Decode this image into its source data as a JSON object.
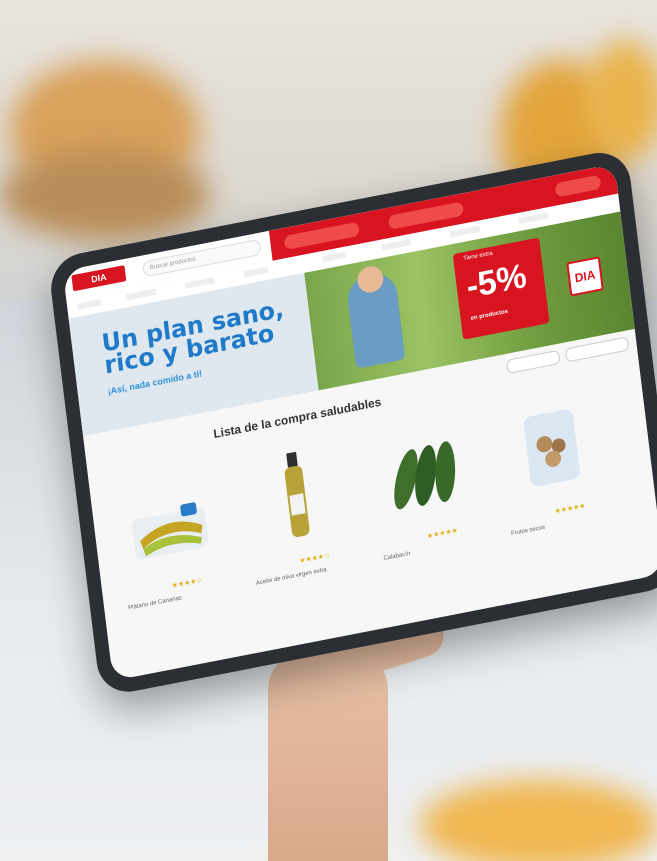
{
  "site": {
    "logo_text": "DIA",
    "search_placeholder": "Buscar productos"
  },
  "hero": {
    "title_line1": "Un plan sano,",
    "title_line2": "rico y barato",
    "subtitle": "¡Así, nada comido a ti!",
    "promo_top": "Tiene extra",
    "promo_value": "-5%",
    "promo_bottom": "en productos",
    "badge_text": "DIA"
  },
  "section": {
    "title": "Lista de la compra saludables"
  },
  "products": [
    {
      "name": "Plátano de Canarias",
      "icon": "banana-pack"
    },
    {
      "name": "Aceite de oliva virgen extra",
      "icon": "olive-oil-bottle"
    },
    {
      "name": "Calabacín",
      "icon": "zucchini"
    },
    {
      "name": "Frutos secos",
      "icon": "nuts-bag"
    }
  ],
  "colors": {
    "brand_red": "#d7141f",
    "hero_blue": "#1f7ac8"
  }
}
